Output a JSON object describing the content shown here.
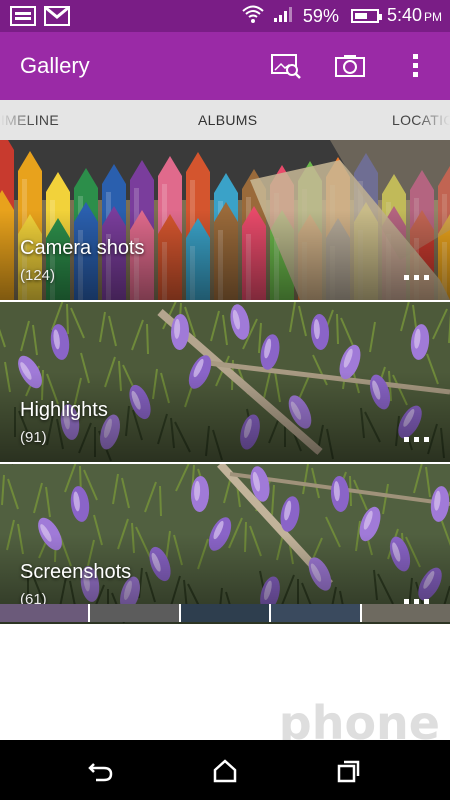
{
  "status_bar": {
    "battery_percent": "59%",
    "battery_level": 0.59,
    "time": "5:40",
    "time_suffix": "PM",
    "icons": [
      "image-notification-icon",
      "gmail-icon",
      "wifi-icon",
      "signal-icon",
      "battery-icon"
    ]
  },
  "app_bar": {
    "title": "Gallery",
    "actions": [
      "search-gallery-icon",
      "camera-icon",
      "overflow-menu-icon"
    ]
  },
  "tabs": [
    "TIMELINE",
    "ALBUMS",
    "LOCATION"
  ],
  "albums": [
    {
      "name": "Camera shots",
      "count": "(124)"
    },
    {
      "name": "Highlights",
      "count": "(91)"
    },
    {
      "name": "Screenshots",
      "count": "(61)"
    }
  ],
  "navigation": [
    "back-icon",
    "home-icon",
    "recents-icon"
  ],
  "watermark": "phone scoop",
  "colors": {
    "status_bar": "#7a1d86",
    "app_bar": "#9a2aa6",
    "tab_bar": "#e5e5e5",
    "nav_bar": "#000000"
  }
}
